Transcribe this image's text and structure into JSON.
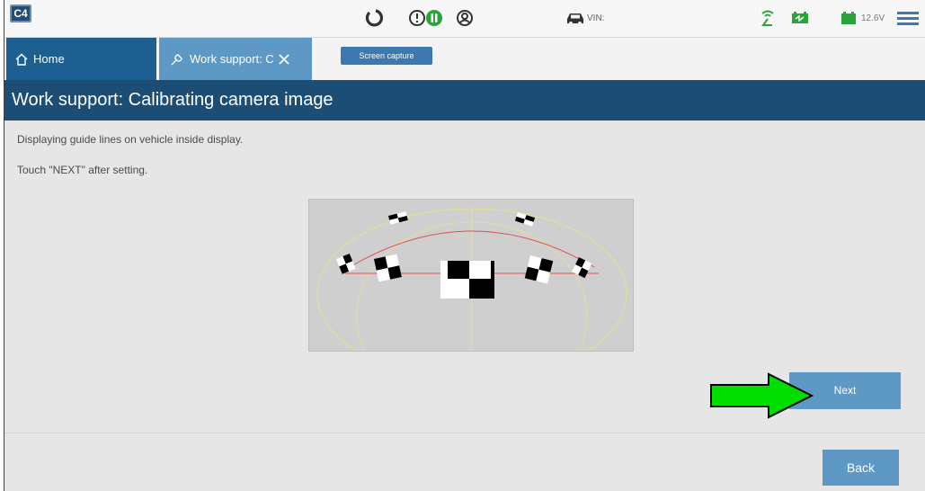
{
  "app": {
    "logo_text": "C4"
  },
  "topbar": {
    "vin_label": "VIN:",
    "voltage": "12.6V",
    "icons": [
      "refresh-icon",
      "alert-icon",
      "pause-icon",
      "user-icon",
      "car-icon",
      "signal-icon",
      "battery-charge-icon",
      "battery-icon",
      "menu-icon"
    ],
    "colors": {
      "green": "#2aa33a",
      "dark": "#333333",
      "menu": "#3a78b5"
    }
  },
  "tabs": [
    {
      "label": "Home",
      "icon": "home-icon"
    },
    {
      "label": "Work support: C",
      "icon": "wrench-icon",
      "close_icon": "close-icon"
    }
  ],
  "tooltip": "Screen capture",
  "page": {
    "title": "Work support: Calibrating camera image",
    "instructions": [
      "Displaying guide lines on vehicle inside display.",
      "Touch \"NEXT\" after setting."
    ]
  },
  "buttons": {
    "next": "Next",
    "back": "Back"
  },
  "colors": {
    "title_bg": "#1b4d75",
    "tab_active": "#1e5f91",
    "button": "#5e98c5",
    "arrow": "#00dd00"
  }
}
